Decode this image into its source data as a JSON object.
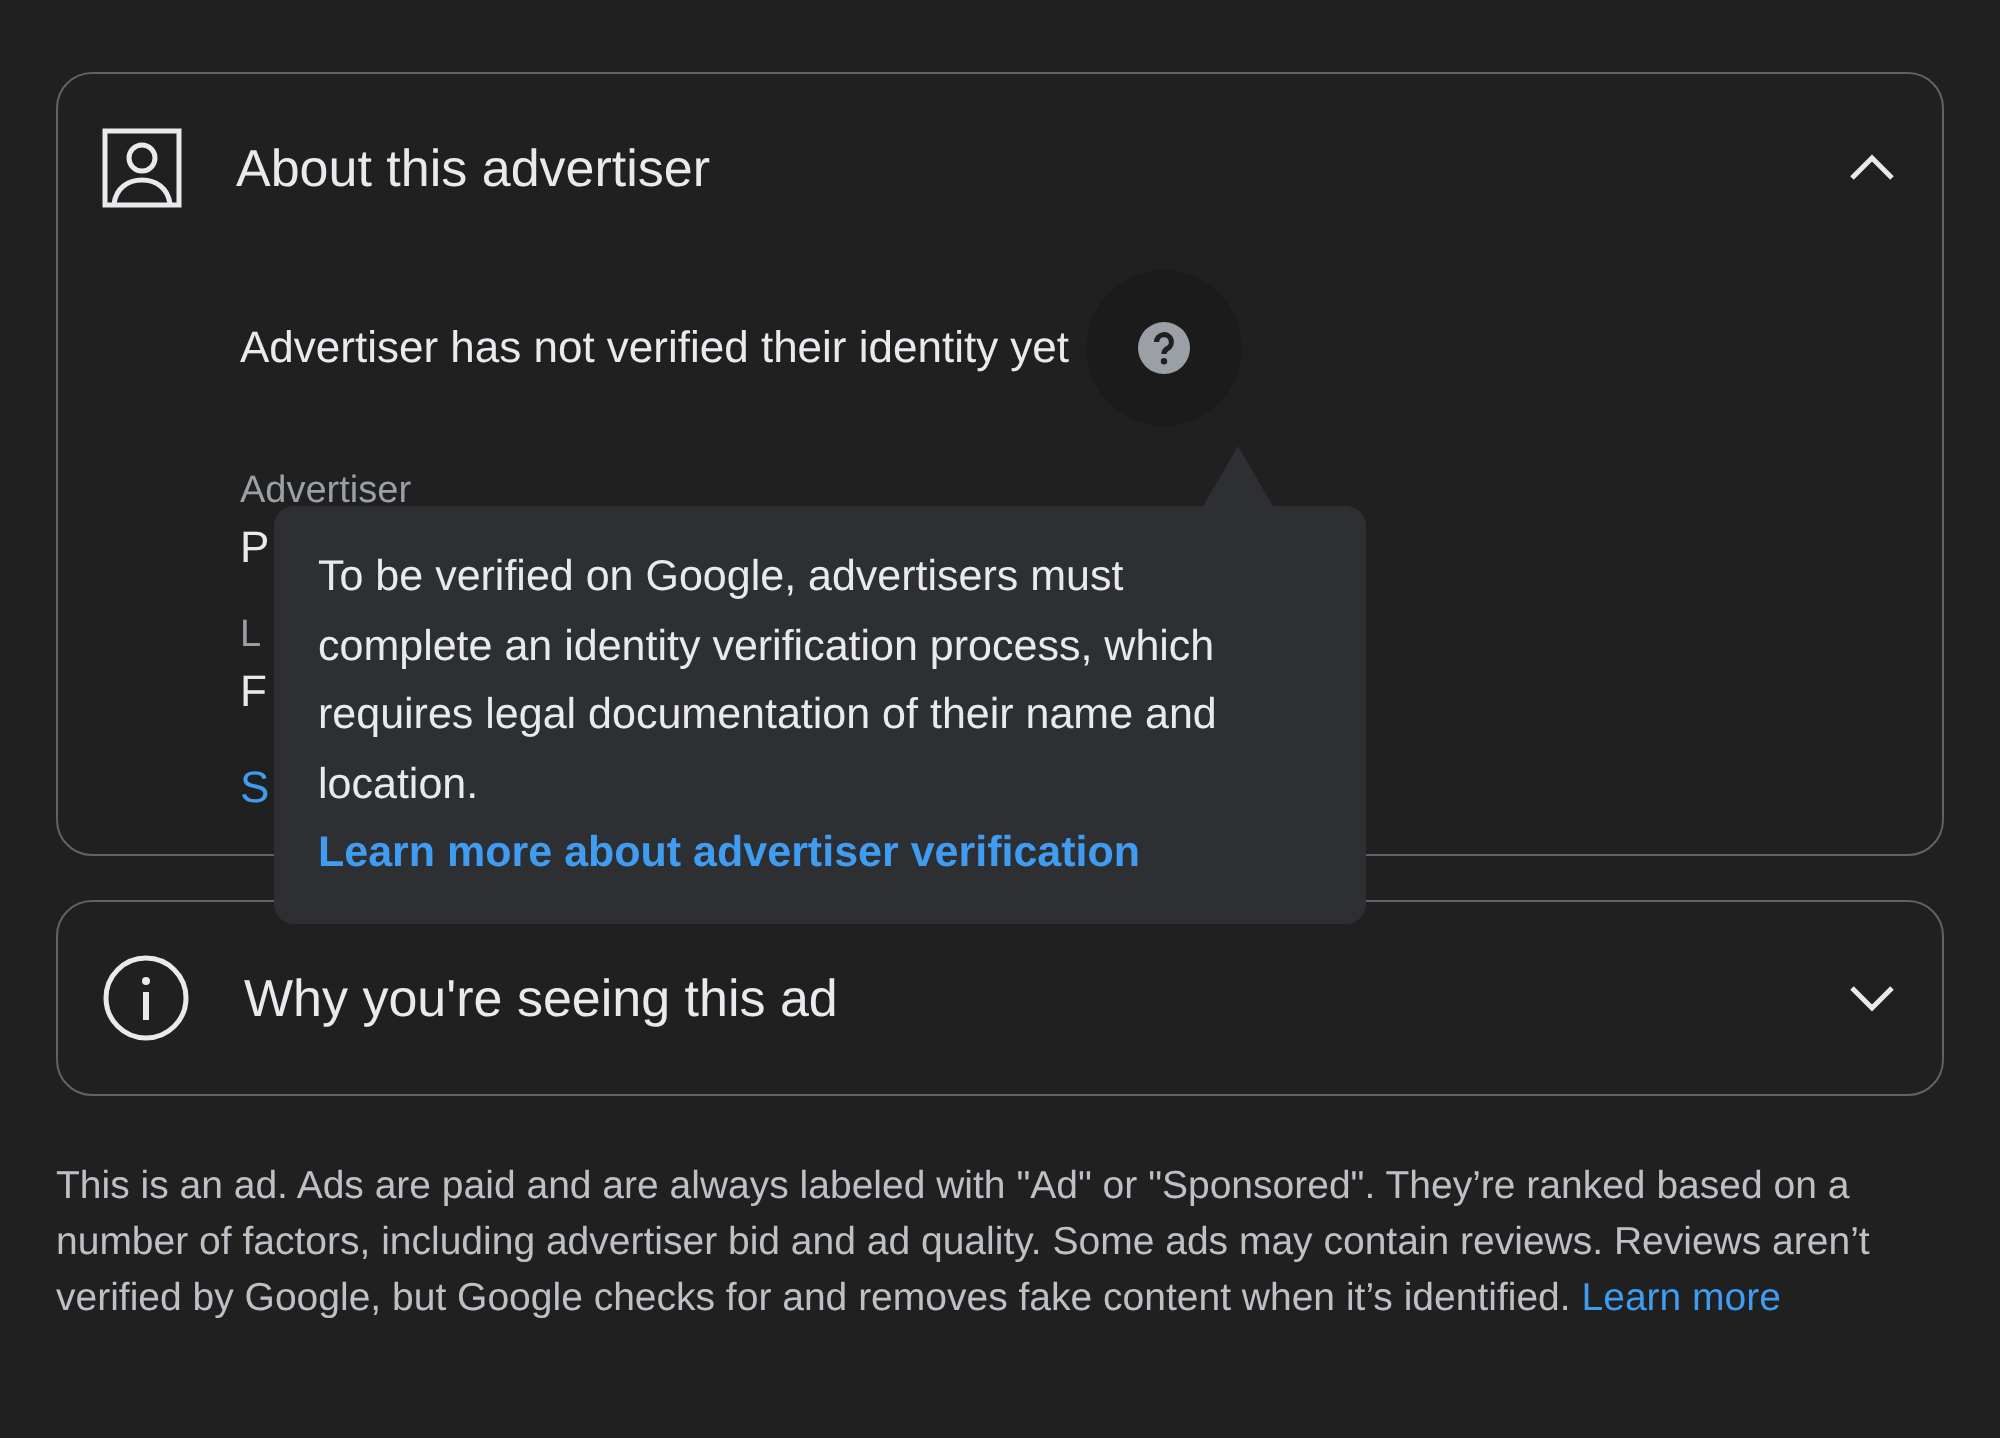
{
  "sections": [
    {
      "kind": "advertiser",
      "title": "About this advertiser",
      "expanded": true,
      "status": "Advertiser has not verified their identity yet",
      "fields": [
        {
          "label": "Advertiser",
          "value": "P"
        },
        {
          "label": "L",
          "value": "F"
        }
      ],
      "link": "S",
      "tooltip": {
        "text": "To be verified on Google, advertisers must complete an identity verification process, which requires legal documentation of their name and location.",
        "link": "Learn more about advertiser verification"
      }
    },
    {
      "kind": "info",
      "title": "Why you're seeing this ad",
      "expanded": false
    }
  ],
  "footer": {
    "text": "This is an ad. Ads are paid and are always labeled with \"Ad\" or \"Sponsored\". They’re ranked based on a number of factors, including advertiser bid and ad quality. Some ads may contain reviews. Reviews aren’t verified by Google, but Google checks for and removes fake content when it’s identified.",
    "link": "Learn more"
  }
}
